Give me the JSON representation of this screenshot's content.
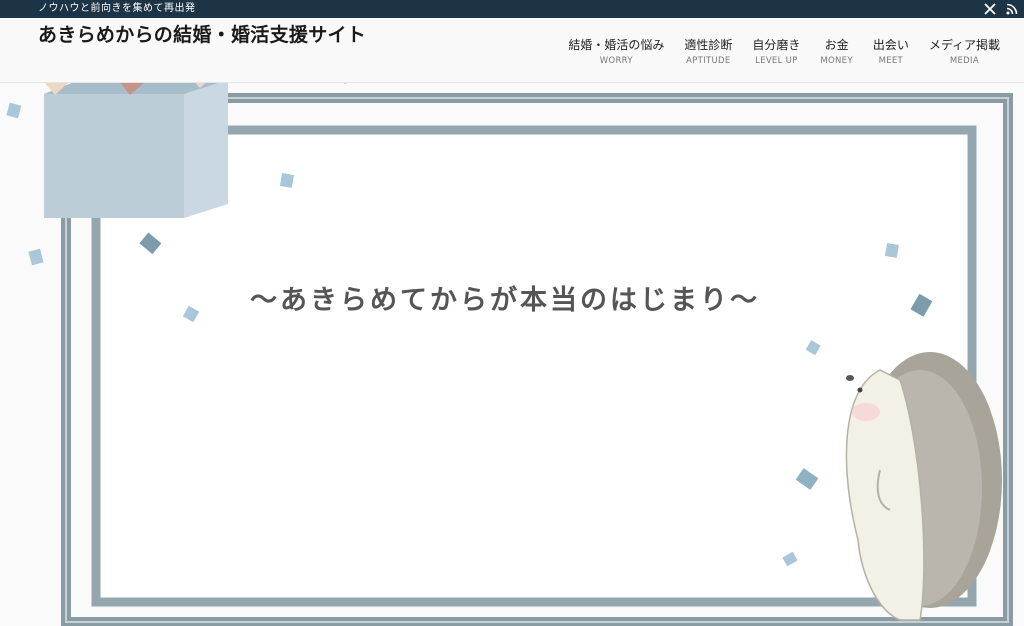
{
  "topbar": {
    "tagline": "ノウハウと前向きを集めて再出発",
    "icons": [
      "x-icon",
      "rss-icon"
    ]
  },
  "header": {
    "site_title": "あきらめからの結婚・婚活支援サイト"
  },
  "nav": [
    {
      "label": "結婚・婚活の悩み",
      "sub": "WORRY"
    },
    {
      "label": "適性診断",
      "sub": "APTITUDE"
    },
    {
      "label": "自分磨き",
      "sub": "LEVEL UP"
    },
    {
      "label": "お金",
      "sub": "MONEY"
    },
    {
      "label": "出会い",
      "sub": "MEET"
    },
    {
      "label": "メディア掲載",
      "sub": "MEDIA"
    }
  ],
  "hero": {
    "catchphrase": "～あきらめてからが本当のはじまり～"
  },
  "colors": {
    "topbar": "#1d3447",
    "frame": "#8a9ba3",
    "box": "#bfd0dc",
    "confetti": "#a9c7d8"
  }
}
